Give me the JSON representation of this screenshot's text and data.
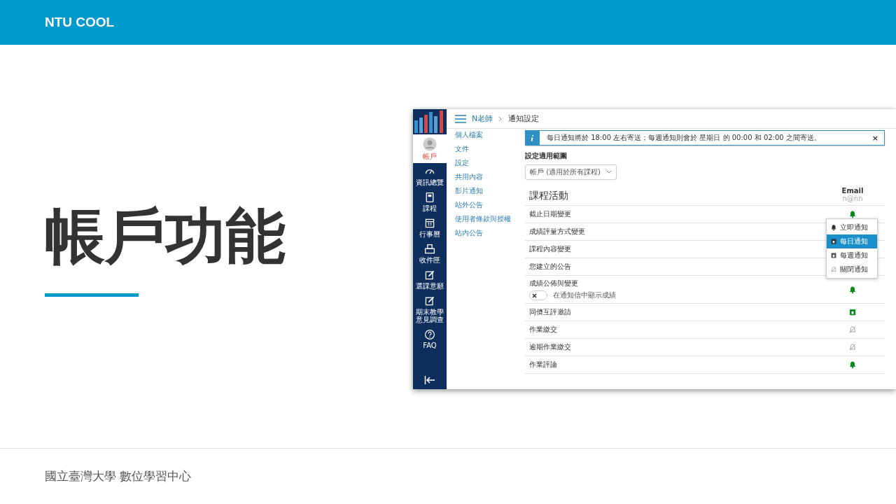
{
  "header": {
    "brand": "NTU COOL"
  },
  "title": "帳戶功能",
  "footer": "國立臺灣大學 數位學習中心",
  "app": {
    "global_nav": [
      {
        "label": "帳戶",
        "kind": "avatar",
        "selected": true
      },
      {
        "label": "資訊總覽",
        "kind": "dashboard",
        "selected": false
      },
      {
        "label": "課程",
        "kind": "course",
        "selected": false
      },
      {
        "label": "行事曆",
        "kind": "calendar",
        "selected": false
      },
      {
        "label": "收件匣",
        "kind": "inbox",
        "selected": false
      },
      {
        "label": "選課意願",
        "kind": "edit",
        "selected": false
      },
      {
        "label": "期末教學意見調查",
        "kind": "edit",
        "selected": false
      },
      {
        "label": "FAQ",
        "kind": "help",
        "selected": false
      }
    ],
    "breadcrumb": [
      "N老師",
      "通知設定"
    ],
    "account_nav": [
      "個人檔案",
      "文件",
      "設定",
      "共用內容",
      "影片通知",
      "站外公告",
      "使用者條款與授權",
      "站內公告"
    ],
    "alert": {
      "text": "每日通知將於 18:00 左右寄送；每週通知則會於 星期日 的 00:00 和 02:00 之間寄送。",
      "close": "×"
    },
    "scope": {
      "label": "設定適用範圍",
      "value": "帳戶 (適用於所有課程)"
    },
    "section_title": "課程活動",
    "channel": {
      "name": "Email",
      "address": "n@nn"
    },
    "rows": [
      {
        "label": "截止日期變更",
        "kind": "immediate"
      },
      {
        "label": "成績評量方式變更"
      },
      {
        "label": "課程內容變更"
      },
      {
        "label": "您建立的公告"
      },
      {
        "label": "成績公佈與變更",
        "kind": "immediate",
        "toggle": {
          "label": "在通知信中顯示成績",
          "on": false
        }
      },
      {
        "label": "同儕互評邀請",
        "kind": "daily"
      },
      {
        "label": "作業繳交",
        "kind": "off"
      },
      {
        "label": "逾期作業繳交",
        "kind": "off"
      },
      {
        "label": "作業評論",
        "kind": "immediate"
      }
    ],
    "email_menu": {
      "open": true,
      "items": [
        {
          "label": "立即通知",
          "kind": "immediate",
          "selected": false
        },
        {
          "label": "每日通知",
          "kind": "daily",
          "selected": true
        },
        {
          "label": "每週通知",
          "kind": "weekly",
          "selected": false
        },
        {
          "label": "關閉通知",
          "kind": "off",
          "selected": false
        }
      ]
    }
  }
}
